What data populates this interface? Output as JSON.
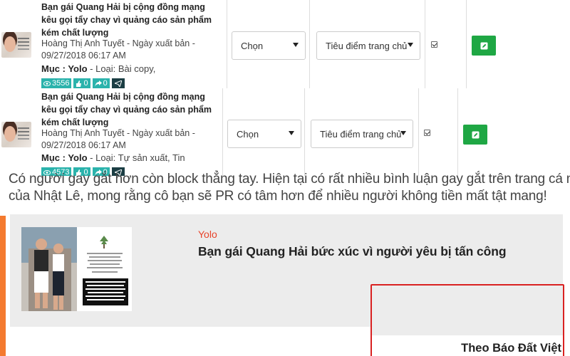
{
  "rows": [
    {
      "title": "Bạn gái Quang Hải bị cộng đồng mạng kêu gọi tẩy chay vì quảng cáo sản phẩm kém chất lượng",
      "author_line": "Hoàng Thị Anh Tuyết - Ngày xuất bản - 09/27/2018 06:17 AM",
      "muc_label": "Mục : Yolo",
      "type_text": " - Loại: Bài copy,",
      "views": "3556",
      "likes": "0",
      "shares": "0",
      "select_label": "Chọn",
      "position_label": "Tiêu điểm trang chủ",
      "checked": true
    },
    {
      "title": "Bạn gái Quang Hải bị cộng đồng mạng kêu gọi tẩy chay vì quảng cáo sản phẩm kém chất lượng",
      "author_line": "Hoàng Thị Anh Tuyết - Ngày xuất bản - 09/27/2018 06:17 AM",
      "muc_label": "Mục : Yolo",
      "type_text": " - Loại: Tự sản xuất, Tin",
      "views": "4573",
      "likes": "0",
      "shares": "0",
      "select_label": "Chọn",
      "position_label": "Tiêu điểm trang chủ",
      "checked": true
    }
  ],
  "article": {
    "cut_line": "Có người gay gắt hơn còn block thẳng tay. Hiện tại có rất nhiều bình luận gay gắt trên trang cá nhân",
    "paragraph": "của Nhật Lê, mong rằng cô bạn sẽ PR có tâm hơn để nhiều người không tiền mất tật mang!",
    "card_category": "Yolo",
    "card_title": "Bạn gái Quang Hải bức xúc vì người yêu bị tấn công",
    "source": "Theo Báo Đất Việt"
  },
  "colors": {
    "badge": "#2bb3ac",
    "share_badge": "#1b3e44",
    "edit_button": "#1fa744",
    "category_red": "#e8432a",
    "accent_orange": "#f47a2f",
    "highlight_red": "#d92121"
  },
  "icons": [
    "eye-icon",
    "thumbs-up-icon",
    "share-icon",
    "send-icon",
    "edit-icon",
    "dropdown-arrow-icon",
    "checkbox-checked-icon"
  ]
}
